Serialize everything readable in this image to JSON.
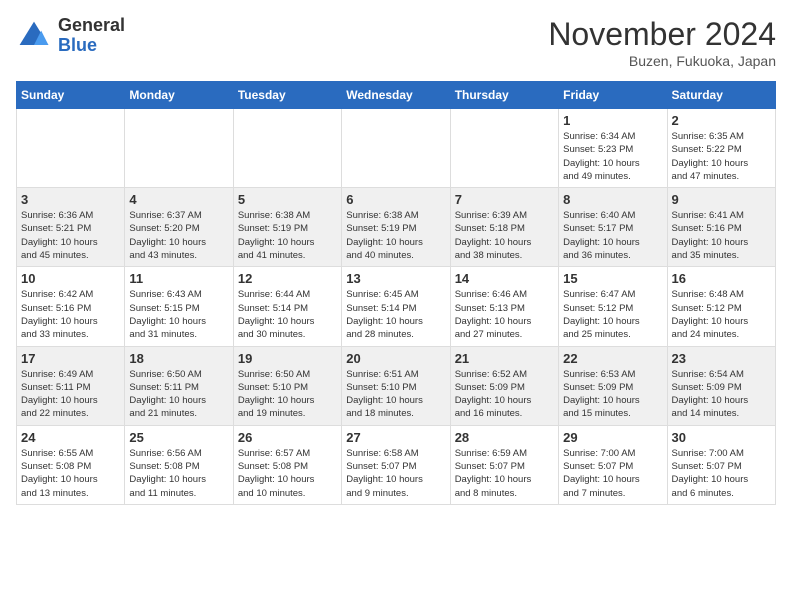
{
  "header": {
    "logo_general": "General",
    "logo_blue": "Blue",
    "month": "November 2024",
    "location": "Buzen, Fukuoka, Japan"
  },
  "days_of_week": [
    "Sunday",
    "Monday",
    "Tuesday",
    "Wednesday",
    "Thursday",
    "Friday",
    "Saturday"
  ],
  "weeks": [
    [
      {
        "day": "",
        "info": ""
      },
      {
        "day": "",
        "info": ""
      },
      {
        "day": "",
        "info": ""
      },
      {
        "day": "",
        "info": ""
      },
      {
        "day": "",
        "info": ""
      },
      {
        "day": "1",
        "info": "Sunrise: 6:34 AM\nSunset: 5:23 PM\nDaylight: 10 hours\nand 49 minutes."
      },
      {
        "day": "2",
        "info": "Sunrise: 6:35 AM\nSunset: 5:22 PM\nDaylight: 10 hours\nand 47 minutes."
      }
    ],
    [
      {
        "day": "3",
        "info": "Sunrise: 6:36 AM\nSunset: 5:21 PM\nDaylight: 10 hours\nand 45 minutes."
      },
      {
        "day": "4",
        "info": "Sunrise: 6:37 AM\nSunset: 5:20 PM\nDaylight: 10 hours\nand 43 minutes."
      },
      {
        "day": "5",
        "info": "Sunrise: 6:38 AM\nSunset: 5:19 PM\nDaylight: 10 hours\nand 41 minutes."
      },
      {
        "day": "6",
        "info": "Sunrise: 6:38 AM\nSunset: 5:19 PM\nDaylight: 10 hours\nand 40 minutes."
      },
      {
        "day": "7",
        "info": "Sunrise: 6:39 AM\nSunset: 5:18 PM\nDaylight: 10 hours\nand 38 minutes."
      },
      {
        "day": "8",
        "info": "Sunrise: 6:40 AM\nSunset: 5:17 PM\nDaylight: 10 hours\nand 36 minutes."
      },
      {
        "day": "9",
        "info": "Sunrise: 6:41 AM\nSunset: 5:16 PM\nDaylight: 10 hours\nand 35 minutes."
      }
    ],
    [
      {
        "day": "10",
        "info": "Sunrise: 6:42 AM\nSunset: 5:16 PM\nDaylight: 10 hours\nand 33 minutes."
      },
      {
        "day": "11",
        "info": "Sunrise: 6:43 AM\nSunset: 5:15 PM\nDaylight: 10 hours\nand 31 minutes."
      },
      {
        "day": "12",
        "info": "Sunrise: 6:44 AM\nSunset: 5:14 PM\nDaylight: 10 hours\nand 30 minutes."
      },
      {
        "day": "13",
        "info": "Sunrise: 6:45 AM\nSunset: 5:14 PM\nDaylight: 10 hours\nand 28 minutes."
      },
      {
        "day": "14",
        "info": "Sunrise: 6:46 AM\nSunset: 5:13 PM\nDaylight: 10 hours\nand 27 minutes."
      },
      {
        "day": "15",
        "info": "Sunrise: 6:47 AM\nSunset: 5:12 PM\nDaylight: 10 hours\nand 25 minutes."
      },
      {
        "day": "16",
        "info": "Sunrise: 6:48 AM\nSunset: 5:12 PM\nDaylight: 10 hours\nand 24 minutes."
      }
    ],
    [
      {
        "day": "17",
        "info": "Sunrise: 6:49 AM\nSunset: 5:11 PM\nDaylight: 10 hours\nand 22 minutes."
      },
      {
        "day": "18",
        "info": "Sunrise: 6:50 AM\nSunset: 5:11 PM\nDaylight: 10 hours\nand 21 minutes."
      },
      {
        "day": "19",
        "info": "Sunrise: 6:50 AM\nSunset: 5:10 PM\nDaylight: 10 hours\nand 19 minutes."
      },
      {
        "day": "20",
        "info": "Sunrise: 6:51 AM\nSunset: 5:10 PM\nDaylight: 10 hours\nand 18 minutes."
      },
      {
        "day": "21",
        "info": "Sunrise: 6:52 AM\nSunset: 5:09 PM\nDaylight: 10 hours\nand 16 minutes."
      },
      {
        "day": "22",
        "info": "Sunrise: 6:53 AM\nSunset: 5:09 PM\nDaylight: 10 hours\nand 15 minutes."
      },
      {
        "day": "23",
        "info": "Sunrise: 6:54 AM\nSunset: 5:09 PM\nDaylight: 10 hours\nand 14 minutes."
      }
    ],
    [
      {
        "day": "24",
        "info": "Sunrise: 6:55 AM\nSunset: 5:08 PM\nDaylight: 10 hours\nand 13 minutes."
      },
      {
        "day": "25",
        "info": "Sunrise: 6:56 AM\nSunset: 5:08 PM\nDaylight: 10 hours\nand 11 minutes."
      },
      {
        "day": "26",
        "info": "Sunrise: 6:57 AM\nSunset: 5:08 PM\nDaylight: 10 hours\nand 10 minutes."
      },
      {
        "day": "27",
        "info": "Sunrise: 6:58 AM\nSunset: 5:07 PM\nDaylight: 10 hours\nand 9 minutes."
      },
      {
        "day": "28",
        "info": "Sunrise: 6:59 AM\nSunset: 5:07 PM\nDaylight: 10 hours\nand 8 minutes."
      },
      {
        "day": "29",
        "info": "Sunrise: 7:00 AM\nSunset: 5:07 PM\nDaylight: 10 hours\nand 7 minutes."
      },
      {
        "day": "30",
        "info": "Sunrise: 7:00 AM\nSunset: 5:07 PM\nDaylight: 10 hours\nand 6 minutes."
      }
    ]
  ]
}
